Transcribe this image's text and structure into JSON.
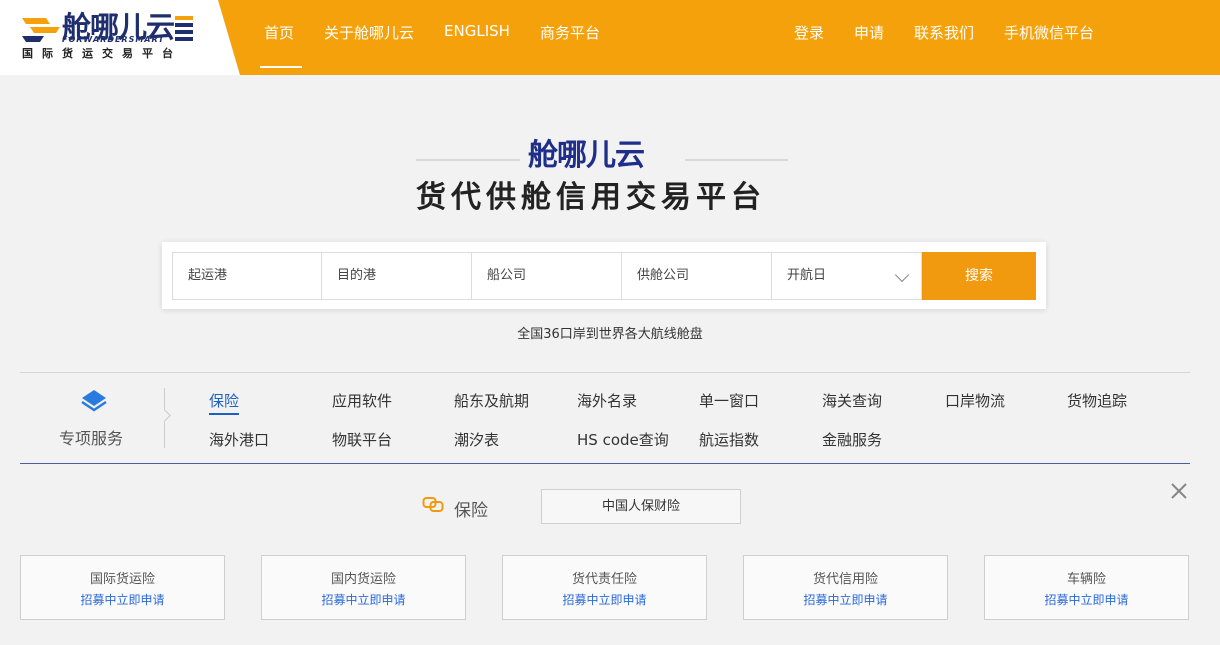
{
  "logo": {
    "name": "舱哪儿云",
    "english": "FORWARDERSMART",
    "subtitle": "国际货运交易平台"
  },
  "nav": {
    "left": [
      "首页",
      "关于舱哪儿云",
      "ENGLISH",
      "商务平台"
    ],
    "right": [
      "登录",
      "申请",
      "联系我们",
      "手机微信平台"
    ],
    "active": "首页"
  },
  "hero": {
    "brand": "舱哪儿云",
    "title": "货代供舱信用交易平台"
  },
  "search": {
    "origin": "起运港",
    "destination": "目的港",
    "carrier": "船公司",
    "supplier": "供舱公司",
    "date": "开航日",
    "button": "搜索"
  },
  "tagline": "全国36口岸到世界各大航线舱盘",
  "services": {
    "label": "专项服务",
    "row1": [
      "保险",
      "应用软件",
      "船东及航期",
      "海外名录",
      "单一窗口",
      "海关查询",
      "口岸物流",
      "货物追踪"
    ],
    "row2": [
      "海外港口",
      "物联平台",
      "潮汐表",
      "HS code查询",
      "航运指数",
      "金融服务"
    ],
    "active": "保险"
  },
  "insurance": {
    "title": "保险",
    "tab": "中国人保财险",
    "cards": [
      {
        "name": "国际货运险",
        "action": "招募中立即申请"
      },
      {
        "name": "国内货运险",
        "action": "招募中立即申请"
      },
      {
        "name": "货代责任险",
        "action": "招募中立即申请"
      },
      {
        "name": "货代信用险",
        "action": "招募中立即申请"
      },
      {
        "name": "车辆险",
        "action": "招募中立即申请"
      }
    ]
  },
  "colors": {
    "header": "#f4a10b",
    "brand_blue": "#1e2e8a",
    "search_button": "#f29a0f",
    "link_blue": "#2a6ad8"
  },
  "icons": [
    "logo-mark-icon",
    "layers-icon",
    "chevron-down-icon",
    "insurance-link-icon",
    "close-icon"
  ]
}
